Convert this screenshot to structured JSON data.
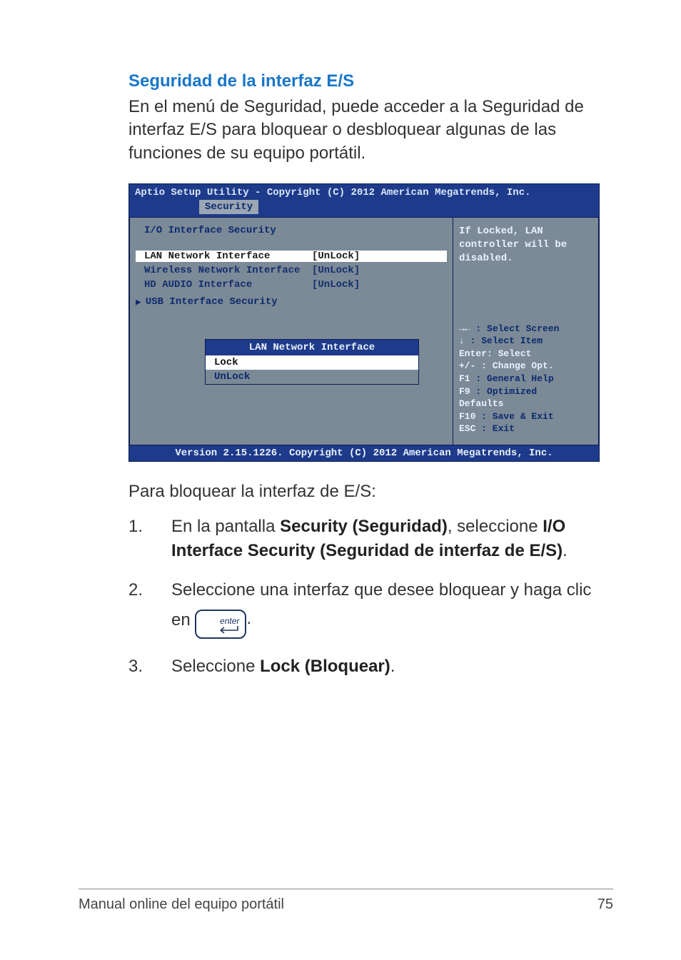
{
  "doc": {
    "section_title": "Seguridad de la interfaz E/S",
    "intro": "En el menú de Seguridad, puede acceder a la Seguridad de interfaz E/S para bloquear o desbloquear algunas de las funciones de su equipo portátil.",
    "after_bios": "Para bloquear la interfaz de E/S:",
    "steps": {
      "s1_a": "En la pantalla ",
      "s1_b": "Security (Seguridad)",
      "s1_c": ", seleccione ",
      "s1_d": "I/O Interface Security (Seguridad de interfaz de E/S)",
      "s1_e": ".",
      "s2_a": "Seleccione una interfaz que desee bloquear y haga clic en",
      "s2_key": "enter",
      "s2_b": ".",
      "s3_a": "Seleccione ",
      "s3_b": "Lock (Bloquear)",
      "s3_c": "."
    },
    "footer_left": "Manual online del equipo portátil",
    "footer_page": "75"
  },
  "bios": {
    "top": "Aptio Setup Utility - Copyright (C) 2012 American Megatrends, Inc.",
    "tab": "Security",
    "heading": "I/O Interface Security",
    "rows": [
      {
        "label": "LAN Network Interface",
        "value": "[UnLock]",
        "selected": true
      },
      {
        "label": "Wireless Network Interface",
        "value": "[UnLock]",
        "selected": false
      },
      {
        "label": "HD AUDIO Interface",
        "value": "[UnLock]",
        "selected": false
      }
    ],
    "submenu": "USB Interface Security",
    "popup": {
      "title": "LAN Network Interface",
      "options": [
        "Lock",
        "UnLock"
      ],
      "selected": 0
    },
    "help": "If Locked, LAN controller will be disabled.",
    "keys": {
      "l1a": "→←",
      "l1b": " : Select Screen",
      "l2a": "↓",
      "l2b": "  : Select Item",
      "l3": "Enter: Select",
      "l4": "+/-  : Change Opt.",
      "l5a": "F1",
      "l5b": "   : General Help",
      "l6a": "F9",
      "l6b": "   : Optimized",
      "l6c": "Defaults",
      "l7a": "F10",
      "l7b": "  : Save & Exit",
      "l8a": "ESC",
      "l8b": "  : Exit"
    },
    "bottom": "Version 2.15.1226. Copyright (C) 2012 American Megatrends, Inc."
  }
}
